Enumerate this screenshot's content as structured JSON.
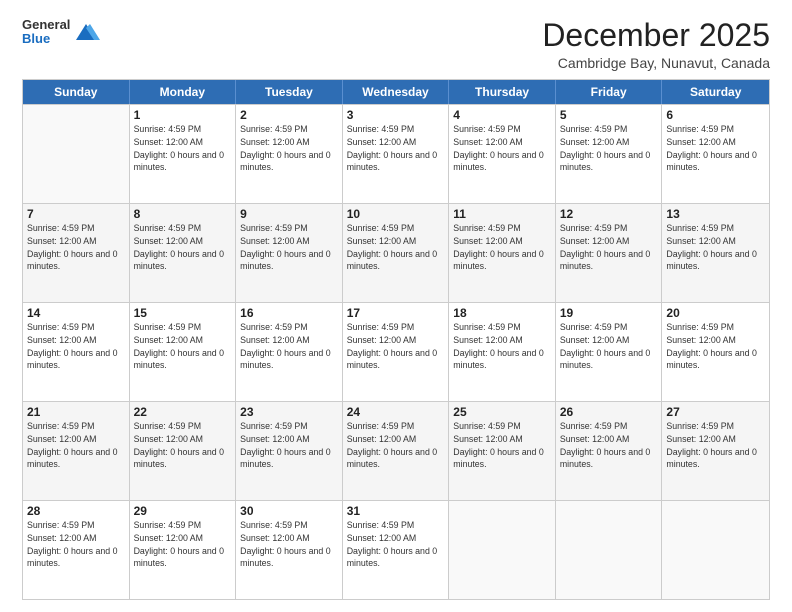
{
  "logo": {
    "general": "General",
    "blue": "Blue"
  },
  "header": {
    "month": "December 2025",
    "location": "Cambridge Bay, Nunavut, Canada"
  },
  "days_of_week": [
    "Sunday",
    "Monday",
    "Tuesday",
    "Wednesday",
    "Thursday",
    "Friday",
    "Saturday"
  ],
  "rows": [
    [
      {
        "day": "",
        "sunrise": "",
        "sunset": "",
        "daylight": ""
      },
      {
        "day": "1",
        "sunrise": "Sunrise: 4:59 PM",
        "sunset": "Sunset: 12:00 AM",
        "daylight": "Daylight: 0 hours and 0 minutes."
      },
      {
        "day": "2",
        "sunrise": "Sunrise: 4:59 PM",
        "sunset": "Sunset: 12:00 AM",
        "daylight": "Daylight: 0 hours and 0 minutes."
      },
      {
        "day": "3",
        "sunrise": "Sunrise: 4:59 PM",
        "sunset": "Sunset: 12:00 AM",
        "daylight": "Daylight: 0 hours and 0 minutes."
      },
      {
        "day": "4",
        "sunrise": "Sunrise: 4:59 PM",
        "sunset": "Sunset: 12:00 AM",
        "daylight": "Daylight: 0 hours and 0 minutes."
      },
      {
        "day": "5",
        "sunrise": "Sunrise: 4:59 PM",
        "sunset": "Sunset: 12:00 AM",
        "daylight": "Daylight: 0 hours and 0 minutes."
      },
      {
        "day": "6",
        "sunrise": "Sunrise: 4:59 PM",
        "sunset": "Sunset: 12:00 AM",
        "daylight": "Daylight: 0 hours and 0 minutes."
      }
    ],
    [
      {
        "day": "7",
        "sunrise": "Sunrise: 4:59 PM",
        "sunset": "Sunset: 12:00 AM",
        "daylight": "Daylight: 0 hours and 0 minutes."
      },
      {
        "day": "8",
        "sunrise": "Sunrise: 4:59 PM",
        "sunset": "Sunset: 12:00 AM",
        "daylight": "Daylight: 0 hours and 0 minutes."
      },
      {
        "day": "9",
        "sunrise": "Sunrise: 4:59 PM",
        "sunset": "Sunset: 12:00 AM",
        "daylight": "Daylight: 0 hours and 0 minutes."
      },
      {
        "day": "10",
        "sunrise": "Sunrise: 4:59 PM",
        "sunset": "Sunset: 12:00 AM",
        "daylight": "Daylight: 0 hours and 0 minutes."
      },
      {
        "day": "11",
        "sunrise": "Sunrise: 4:59 PM",
        "sunset": "Sunset: 12:00 AM",
        "daylight": "Daylight: 0 hours and 0 minutes."
      },
      {
        "day": "12",
        "sunrise": "Sunrise: 4:59 PM",
        "sunset": "Sunset: 12:00 AM",
        "daylight": "Daylight: 0 hours and 0 minutes."
      },
      {
        "day": "13",
        "sunrise": "Sunrise: 4:59 PM",
        "sunset": "Sunset: 12:00 AM",
        "daylight": "Daylight: 0 hours and 0 minutes."
      }
    ],
    [
      {
        "day": "14",
        "sunrise": "Sunrise: 4:59 PM",
        "sunset": "Sunset: 12:00 AM",
        "daylight": "Daylight: 0 hours and 0 minutes."
      },
      {
        "day": "15",
        "sunrise": "Sunrise: 4:59 PM",
        "sunset": "Sunset: 12:00 AM",
        "daylight": "Daylight: 0 hours and 0 minutes."
      },
      {
        "day": "16",
        "sunrise": "Sunrise: 4:59 PM",
        "sunset": "Sunset: 12:00 AM",
        "daylight": "Daylight: 0 hours and 0 minutes."
      },
      {
        "day": "17",
        "sunrise": "Sunrise: 4:59 PM",
        "sunset": "Sunset: 12:00 AM",
        "daylight": "Daylight: 0 hours and 0 minutes."
      },
      {
        "day": "18",
        "sunrise": "Sunrise: 4:59 PM",
        "sunset": "Sunset: 12:00 AM",
        "daylight": "Daylight: 0 hours and 0 minutes."
      },
      {
        "day": "19",
        "sunrise": "Sunrise: 4:59 PM",
        "sunset": "Sunset: 12:00 AM",
        "daylight": "Daylight: 0 hours and 0 minutes."
      },
      {
        "day": "20",
        "sunrise": "Sunrise: 4:59 PM",
        "sunset": "Sunset: 12:00 AM",
        "daylight": "Daylight: 0 hours and 0 minutes."
      }
    ],
    [
      {
        "day": "21",
        "sunrise": "Sunrise: 4:59 PM",
        "sunset": "Sunset: 12:00 AM",
        "daylight": "Daylight: 0 hours and 0 minutes."
      },
      {
        "day": "22",
        "sunrise": "Sunrise: 4:59 PM",
        "sunset": "Sunset: 12:00 AM",
        "daylight": "Daylight: 0 hours and 0 minutes."
      },
      {
        "day": "23",
        "sunrise": "Sunrise: 4:59 PM",
        "sunset": "Sunset: 12:00 AM",
        "daylight": "Daylight: 0 hours and 0 minutes."
      },
      {
        "day": "24",
        "sunrise": "Sunrise: 4:59 PM",
        "sunset": "Sunset: 12:00 AM",
        "daylight": "Daylight: 0 hours and 0 minutes."
      },
      {
        "day": "25",
        "sunrise": "Sunrise: 4:59 PM",
        "sunset": "Sunset: 12:00 AM",
        "daylight": "Daylight: 0 hours and 0 minutes."
      },
      {
        "day": "26",
        "sunrise": "Sunrise: 4:59 PM",
        "sunset": "Sunset: 12:00 AM",
        "daylight": "Daylight: 0 hours and 0 minutes."
      },
      {
        "day": "27",
        "sunrise": "Sunrise: 4:59 PM",
        "sunset": "Sunset: 12:00 AM",
        "daylight": "Daylight: 0 hours and 0 minutes."
      }
    ],
    [
      {
        "day": "28",
        "sunrise": "Sunrise: 4:59 PM",
        "sunset": "Sunset: 12:00 AM",
        "daylight": "Daylight: 0 hours and 0 minutes."
      },
      {
        "day": "29",
        "sunrise": "Sunrise: 4:59 PM",
        "sunset": "Sunset: 12:00 AM",
        "daylight": "Daylight: 0 hours and 0 minutes."
      },
      {
        "day": "30",
        "sunrise": "Sunrise: 4:59 PM",
        "sunset": "Sunset: 12:00 AM",
        "daylight": "Daylight: 0 hours and 0 minutes."
      },
      {
        "day": "31",
        "sunrise": "Sunrise: 4:59 PM",
        "sunset": "Sunset: 12:00 AM",
        "daylight": "Daylight: 0 hours and 0 minutes."
      },
      {
        "day": "",
        "sunrise": "",
        "sunset": "",
        "daylight": ""
      },
      {
        "day": "",
        "sunrise": "",
        "sunset": "",
        "daylight": ""
      },
      {
        "day": "",
        "sunrise": "",
        "sunset": "",
        "daylight": ""
      }
    ]
  ]
}
